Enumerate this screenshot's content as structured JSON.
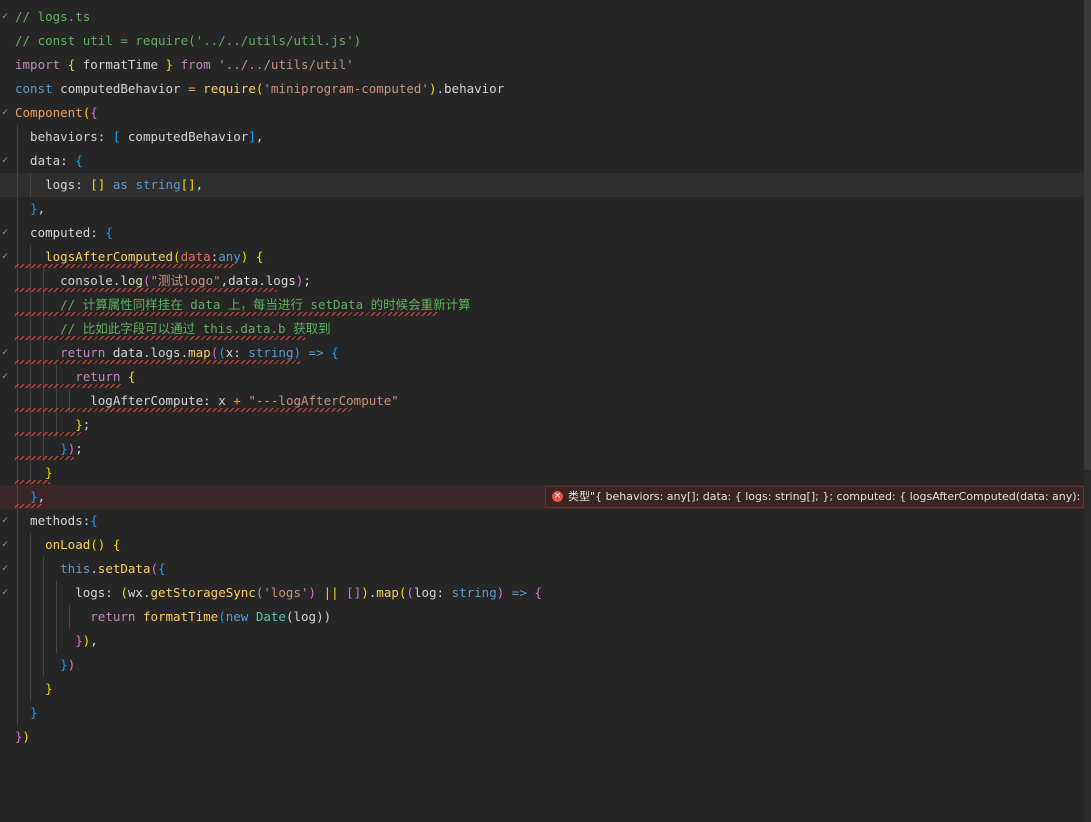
{
  "editor": {
    "lines": [
      {
        "check": "✓",
        "tokens": [
          {
            "c": "t-comment",
            "t": "// logs.ts"
          }
        ]
      },
      {
        "check": "",
        "tokens": [
          {
            "c": "t-comment",
            "t": "// const util = require('../../utils/util.js')"
          }
        ]
      },
      {
        "check": "",
        "tokens": [
          {
            "c": "t-kw2",
            "t": "import"
          },
          {
            "c": "",
            "t": " "
          },
          {
            "c": "t-pun",
            "t": "{"
          },
          {
            "c": "",
            "t": " formatTime "
          },
          {
            "c": "t-pun",
            "t": "}"
          },
          {
            "c": "",
            "t": " "
          },
          {
            "c": "t-kw2",
            "t": "from"
          },
          {
            "c": "",
            "t": " "
          },
          {
            "c": "t-str",
            "t": "'../../utils/util'"
          }
        ]
      },
      {
        "check": "",
        "tokens": [
          {
            "c": "t-kw",
            "t": "const"
          },
          {
            "c": "",
            "t": " computedBehavior "
          },
          {
            "c": "t-org",
            "t": "="
          },
          {
            "c": "",
            "t": " "
          },
          {
            "c": "t-fn2",
            "t": "require"
          },
          {
            "c": "t-pun",
            "t": "("
          },
          {
            "c": "t-str",
            "t": "'miniprogram-computed'"
          },
          {
            "c": "t-pun",
            "t": ")"
          },
          {
            "c": "",
            "t": ".behavior"
          }
        ]
      },
      {
        "check": "✓",
        "tokens": [
          {
            "c": "t-kwo",
            "t": "Component"
          },
          {
            "c": "t-pun",
            "t": "("
          },
          {
            "c": "t-pun2",
            "t": "{"
          }
        ]
      },
      {
        "check": "",
        "tokens": [
          {
            "c": "",
            "t": "  behaviors: "
          },
          {
            "c": "t-pun3",
            "t": "["
          },
          {
            "c": "",
            "t": " computedBehavior"
          },
          {
            "c": "t-pun3",
            "t": "]"
          },
          {
            "c": "",
            "t": ","
          }
        ]
      },
      {
        "check": "✓",
        "tokens": [
          {
            "c": "",
            "t": "  data: "
          },
          {
            "c": "t-pun3",
            "t": "{"
          }
        ]
      },
      {
        "check": "",
        "tokens": [
          {
            "c": "",
            "t": "    logs: "
          },
          {
            "c": "t-pun",
            "t": "[]"
          },
          {
            "c": "",
            "t": " "
          },
          {
            "c": "t-kw",
            "t": "as"
          },
          {
            "c": "",
            "t": " "
          },
          {
            "c": "t-kw",
            "t": "string"
          },
          {
            "c": "t-pun",
            "t": "[]"
          },
          {
            "c": "",
            "t": ","
          }
        ]
      },
      {
        "check": "",
        "tokens": [
          {
            "c": "",
            "t": "  "
          },
          {
            "c": "t-pun3",
            "t": "}"
          },
          {
            "c": "",
            "t": ","
          }
        ]
      },
      {
        "check": "✓",
        "tokens": [
          {
            "c": "",
            "t": "  computed: "
          },
          {
            "c": "t-pun3",
            "t": "{"
          }
        ]
      },
      {
        "check": "✓",
        "tokens": [
          {
            "c": "",
            "t": "    "
          },
          {
            "c": "t-fn2",
            "t": "logsAfterComputed"
          },
          {
            "c": "t-pun",
            "t": "("
          },
          {
            "c": "t-red",
            "t": "data"
          },
          {
            "c": "",
            "t": ":"
          },
          {
            "c": "t-kw",
            "t": "any"
          },
          {
            "c": "t-pun",
            "t": ")"
          },
          {
            "c": "",
            "t": " "
          },
          {
            "c": "t-pun",
            "t": "{"
          }
        ]
      },
      {
        "check": "",
        "tokens": [
          {
            "c": "",
            "t": "      console."
          },
          {
            "c": "t-fn",
            "t": "log"
          },
          {
            "c": "t-pun2",
            "t": "("
          },
          {
            "c": "t-str",
            "t": "\"测试logo\""
          },
          {
            "c": "",
            "t": ",data.logs"
          },
          {
            "c": "t-pun2",
            "t": ")"
          },
          {
            "c": "",
            "t": ";"
          }
        ]
      },
      {
        "check": "",
        "tokens": [
          {
            "c": "",
            "t": "      "
          },
          {
            "c": "t-comment",
            "t": "// 计算属性同样挂在 data 上，每当进行 setData 的时候会重新计算"
          }
        ]
      },
      {
        "check": "",
        "tokens": [
          {
            "c": "",
            "t": "      "
          },
          {
            "c": "t-comment",
            "t": "// 比如此字段可以通过 this.data.b 获取到"
          }
        ]
      },
      {
        "check": "✓",
        "tokens": [
          {
            "c": "",
            "t": "      "
          },
          {
            "c": "t-kw2",
            "t": "return"
          },
          {
            "c": "",
            "t": " data.logs."
          },
          {
            "c": "t-fn2",
            "t": "map"
          },
          {
            "c": "t-pun2",
            "t": "("
          },
          {
            "c": "t-pun3",
            "t": "("
          },
          {
            "c": "",
            "t": "x: "
          },
          {
            "c": "t-kw",
            "t": "string"
          },
          {
            "c": "t-pun3",
            "t": ")"
          },
          {
            "c": "",
            "t": " "
          },
          {
            "c": "t-kw",
            "t": "=>"
          },
          {
            "c": "",
            "t": " "
          },
          {
            "c": "t-pun3",
            "t": "{"
          }
        ]
      },
      {
        "check": "✓",
        "tokens": [
          {
            "c": "",
            "t": "        "
          },
          {
            "c": "t-kw2",
            "t": "return"
          },
          {
            "c": "",
            "t": " "
          },
          {
            "c": "t-pun",
            "t": "{"
          }
        ]
      },
      {
        "check": "",
        "tokens": [
          {
            "c": "",
            "t": "          logAfterCompute: x "
          },
          {
            "c": "t-org",
            "t": "+"
          },
          {
            "c": "",
            "t": " "
          },
          {
            "c": "t-str",
            "t": "\"---logAfterCompute\""
          }
        ]
      },
      {
        "check": "",
        "tokens": [
          {
            "c": "",
            "t": "        "
          },
          {
            "c": "t-pun",
            "t": "}"
          },
          {
            "c": "",
            "t": ";"
          }
        ]
      },
      {
        "check": "",
        "tokens": [
          {
            "c": "",
            "t": "      "
          },
          {
            "c": "t-pun3",
            "t": "}"
          },
          {
            "c": "t-pun2",
            "t": ")"
          },
          {
            "c": "",
            "t": ";"
          }
        ]
      },
      {
        "check": "",
        "tokens": [
          {
            "c": "",
            "t": "    "
          },
          {
            "c": "t-pun",
            "t": "}"
          }
        ]
      },
      {
        "check": "",
        "tokens": [
          {
            "c": "",
            "t": "  "
          },
          {
            "c": "t-pun3",
            "t": "}"
          },
          {
            "c": "",
            "t": ","
          }
        ]
      },
      {
        "check": "✓",
        "tokens": [
          {
            "c": "",
            "t": "  methods:"
          },
          {
            "c": "t-pun3",
            "t": "{"
          }
        ]
      },
      {
        "check": "✓",
        "tokens": [
          {
            "c": "",
            "t": "    "
          },
          {
            "c": "t-fn2",
            "t": "onLoad"
          },
          {
            "c": "t-pun",
            "t": "()"
          },
          {
            "c": "",
            "t": " "
          },
          {
            "c": "t-pun",
            "t": "{"
          }
        ]
      },
      {
        "check": "✓",
        "tokens": [
          {
            "c": "",
            "t": "      "
          },
          {
            "c": "t-kw",
            "t": "this"
          },
          {
            "c": "",
            "t": "."
          },
          {
            "c": "t-fn2",
            "t": "setData"
          },
          {
            "c": "t-pun2",
            "t": "("
          },
          {
            "c": "t-pun3",
            "t": "{"
          }
        ]
      },
      {
        "check": "✓",
        "tokens": [
          {
            "c": "",
            "t": "        logs: "
          },
          {
            "c": "t-pun",
            "t": "("
          },
          {
            "c": "",
            "t": "wx."
          },
          {
            "c": "t-fn2",
            "t": "getStorageSync"
          },
          {
            "c": "t-pun2",
            "t": "("
          },
          {
            "c": "t-str",
            "t": "'logs'"
          },
          {
            "c": "t-pun2",
            "t": ")"
          },
          {
            "c": "",
            "t": " "
          },
          {
            "c": "t-pun",
            "t": "||"
          },
          {
            "c": "",
            "t": " "
          },
          {
            "c": "t-pun2",
            "t": "[]"
          },
          {
            "c": "t-pun",
            "t": ")"
          },
          {
            "c": "",
            "t": "."
          },
          {
            "c": "t-fn2",
            "t": "map"
          },
          {
            "c": "t-pun",
            "t": "("
          },
          {
            "c": "t-pun2",
            "t": "("
          },
          {
            "c": "",
            "t": "log: "
          },
          {
            "c": "t-kw",
            "t": "string"
          },
          {
            "c": "t-pun2",
            "t": ")"
          },
          {
            "c": "",
            "t": " "
          },
          {
            "c": "t-kw",
            "t": "=>"
          },
          {
            "c": "",
            "t": " "
          },
          {
            "c": "t-pun2",
            "t": "{"
          }
        ]
      },
      {
        "check": "",
        "tokens": [
          {
            "c": "",
            "t": "          "
          },
          {
            "c": "t-kw2",
            "t": "return"
          },
          {
            "c": "",
            "t": " "
          },
          {
            "c": "t-fn2",
            "t": "formatTime"
          },
          {
            "c": "t-pun3",
            "t": "("
          },
          {
            "c": "t-kw",
            "t": "new"
          },
          {
            "c": "",
            "t": " "
          },
          {
            "c": "t-ty",
            "t": "Date"
          },
          {
            "c": "",
            "t": "(log))"
          }
        ]
      },
      {
        "check": "",
        "tokens": [
          {
            "c": "",
            "t": "        "
          },
          {
            "c": "t-pun2",
            "t": "}"
          },
          {
            "c": "t-pun",
            "t": ")"
          },
          {
            "c": "",
            "t": ","
          }
        ]
      },
      {
        "check": "",
        "tokens": [
          {
            "c": "",
            "t": "      "
          },
          {
            "c": "t-pun3",
            "t": "}"
          },
          {
            "c": "t-pun2",
            "t": ")"
          }
        ]
      },
      {
        "check": "",
        "tokens": [
          {
            "c": "",
            "t": "    "
          },
          {
            "c": "t-pun",
            "t": "}"
          }
        ]
      },
      {
        "check": "",
        "tokens": [
          {
            "c": "",
            "t": "  "
          },
          {
            "c": "t-pun3",
            "t": "}"
          }
        ]
      },
      {
        "check": "",
        "tokens": [
          {
            "c": "t-pun2",
            "t": "}"
          },
          {
            "c": "t-pun",
            "t": ")"
          }
        ]
      }
    ]
  },
  "error_hint": {
    "icon": "error-icon",
    "text": "类型\"{ behaviors: any[]; data: { logs: string[]; }; computed: { logsAfterComputed(data: any): any; }; ..."
  },
  "colors": {
    "background": "#262626",
    "comment": "#5db35d",
    "error": "#e8453c"
  }
}
